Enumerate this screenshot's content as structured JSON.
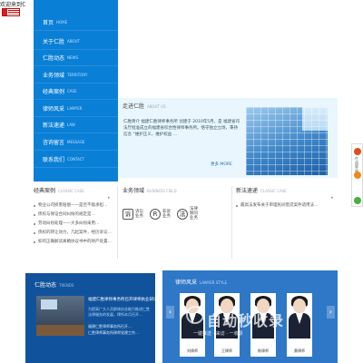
{
  "header": {
    "title": "欢迎来到仁胜的网"
  },
  "nav": {
    "items": [
      {
        "cn": "首页",
        "en": "HOME"
      },
      {
        "cn": "关于仁胜",
        "en": "ABOUT"
      },
      {
        "cn": "仁胜动态",
        "en": "NEWS"
      },
      {
        "cn": "业务领域",
        "en": "TERRITORY"
      },
      {
        "cn": "经典案例",
        "en": "CASE"
      },
      {
        "cn": "律师风采",
        "en": "LAWYER"
      },
      {
        "cn": "新法速递",
        "en": "LAW"
      },
      {
        "cn": "咨询留言",
        "en": "MESSAGE"
      },
      {
        "cn": "联系我们",
        "en": "CONTACT"
      }
    ]
  },
  "about": {
    "title": "走进仁胜",
    "title_en": "ABOUT US",
    "text": "仁胜简介 福建仁胜律师事务所 创建于 2010年5月，是 福建省司法厅批准成立的福建省综合性律师事务所。恪守独立立场，秉持 信念 “维护正义，维护权益 …",
    "more": "更多 MORE"
  },
  "float_bar": {
    "label": "在线客服"
  },
  "cases": {
    "title": "经典案例",
    "title_en": "CLASSIC CASE",
    "items": [
      "物业公司损害赔偿——是否不能承担…",
      "债权与保证合同纠纷的规定是…",
      "劳动纠纷处理——大多纠纷采用…",
      "债权的转让效力，几起案件，经历诉讼…",
      "如何正确解读离婚协议书中的财产处置…"
    ]
  },
  "business": {
    "title": "业务领域",
    "title_en": "BUSINESS FIELD",
    "items": [
      {
        "icon": "诉",
        "label": "诉讼业务"
      },
      {
        "icon": "R",
        "label": "非诉业务"
      },
      {
        "icon": "法",
        "label": "法律顾问业务"
      }
    ]
  },
  "laws": {
    "title": "新法速递",
    "title_en": "CLASSIC CASE",
    "items": [
      "最高法发布关于审理民间借贷案件适用法…"
    ]
  },
  "news": {
    "title": "仁胜动态",
    "title_en": "TRENDS",
    "headline": "福建仁胜律师事务所召开律师执业研讨…",
    "summary": "为提高广大人员群体执业能力推进仁胜法律服务的发展，律所本月召开…",
    "list": [
      "福建仁胜律师事务所召开…",
      "仁胜律师事务所律师党建工作…"
    ]
  },
  "lawyers": {
    "title": "律师风采",
    "title_en": "LAWYER STYLE",
    "people": [
      {
        "name": "刘律师"
      },
      {
        "name": "王律师"
      },
      {
        "name": "陈律师"
      },
      {
        "name": "黄律师"
      },
      {
        "name": "郑律师"
      }
    ]
  },
  "watermark": {
    "text": "自动秒收录",
    "sub": "一键推送 · 来访 · 一收录"
  }
}
